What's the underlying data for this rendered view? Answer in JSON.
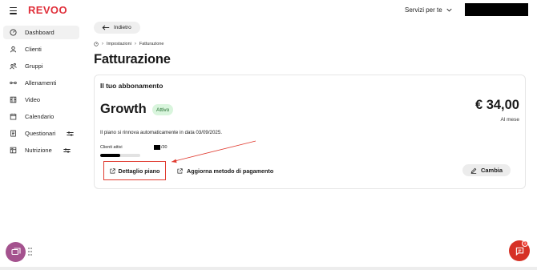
{
  "header": {
    "logo": "REVOO",
    "services_label": "Servizi per te",
    "icons": {
      "menu": "hamburger-icon",
      "services": "chevron-down-icon"
    }
  },
  "sidebar": {
    "items": [
      {
        "label": "Dashboard",
        "icon": "gauge-icon",
        "active": true
      },
      {
        "label": "Clienti",
        "icon": "user-icon",
        "active": false
      },
      {
        "label": "Gruppi",
        "icon": "group-icon",
        "active": false
      },
      {
        "label": "Allenamenti",
        "icon": "dumbbell-icon",
        "active": false
      },
      {
        "label": "Video",
        "icon": "video-icon",
        "active": false
      },
      {
        "label": "Calendario",
        "icon": "calendar-icon",
        "active": false
      },
      {
        "label": "Questionari",
        "icon": "document-icon",
        "active": false,
        "tag_icon": "sliders-icon"
      },
      {
        "label": "Nutrizione",
        "icon": "nutrition-icon",
        "active": false,
        "tag_icon": "sliders-icon"
      }
    ]
  },
  "main": {
    "back_label": "Indietro",
    "breadcrumb": [
      "Impostazioni",
      "Fatturazione"
    ],
    "title": "Fatturazione",
    "subscription": {
      "heading": "Il tuo abbonamento",
      "plan_name": "Growth",
      "status": "Attivo",
      "price": "€ 34,00",
      "period": "Al mese",
      "renewal_text": "Il piano si rinnova automaticamente in data 03/09/2025.",
      "clients_label": "Clienti attivi",
      "clients_total": "/30",
      "clients_fill": 0.5,
      "detail_button": "Dettaglio piano",
      "payment_button": "Aggiorna metodo di pagamento",
      "change_button": "Cambia"
    }
  },
  "widgets": {
    "chat_badge": "1"
  },
  "colors": {
    "brand": "#e02f3a",
    "badge_bg": "#d9f5dd",
    "badge_text": "#1f6b2b",
    "support_fab": "#a4528e",
    "chat_fab": "#d63125",
    "annotation": "#e03a2f"
  }
}
